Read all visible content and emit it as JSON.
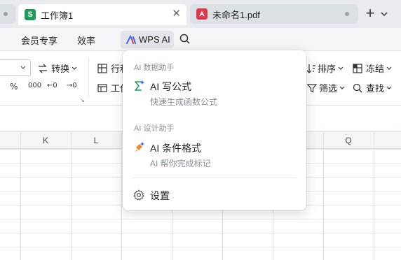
{
  "tabs": [
    {
      "label": "工作簿1",
      "icon_letter": "S",
      "icon": "spreadsheet-icon",
      "active": true
    },
    {
      "label": "未命名1.pdf",
      "icon": "pdf-icon",
      "active": false
    }
  ],
  "menubar": {
    "items": [
      "会员专享",
      "效率"
    ],
    "wps_ai_label": "WPS AI"
  },
  "ribbon": {
    "convert_label": "转换",
    "row_col_label": "行和",
    "worksheet_label": "工作",
    "sort_label": "排序",
    "freeze_label": "冻结",
    "filter_label": "筛选",
    "find_label": "查找",
    "number_formats": [
      "%",
      "000",
      "←0",
      "→0"
    ]
  },
  "columns": [
    "K",
    "L",
    "Q"
  ],
  "dropdown": {
    "section1": "AI 数据助手",
    "item1_title": "AI 写公式",
    "item1_sub": "快速生成函数公式",
    "section2": "AI 设计助手",
    "item2_title": "AI 条件格式",
    "item2_sub": "AI 帮你完成标记",
    "settings_label": "设置"
  },
  "colors": {
    "accent_green": "#1f9d55",
    "pdf_red": "#e0384b",
    "ai_blue": "#3b6cf6",
    "ai_orange": "#f08a24"
  }
}
